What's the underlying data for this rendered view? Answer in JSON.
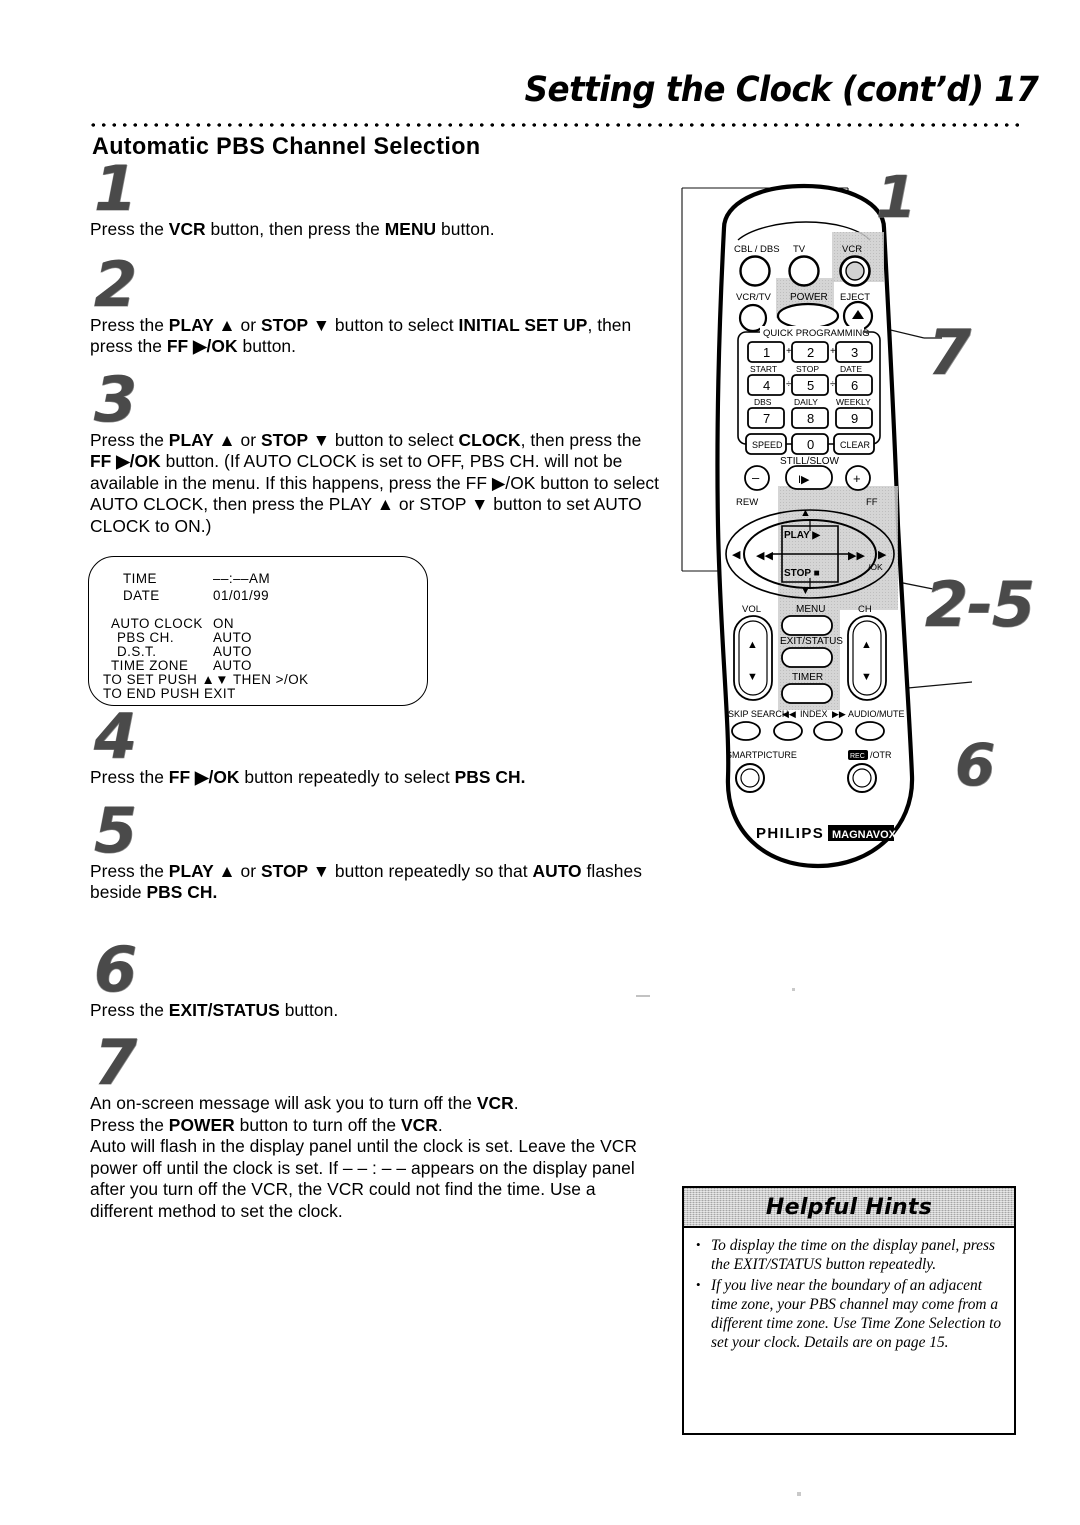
{
  "header": {
    "title": "Setting the Clock (cont’d)  17",
    "section_heading": "Automatic PBS Channel Selection"
  },
  "steps": [
    {
      "number": "1",
      "text_html": "Press the <b>VCR</b> button, then press the <b>MENU</b> button.",
      "plain": "Press the VCR button, then press the MENU button."
    },
    {
      "number": "2",
      "text_html": "Press the <b>PLAY ▲</b> or <b>STOP ▼</b> button to select <b>INITIAL SET UP</b>, then press the <b>FF ▶/OK</b> button.",
      "plain": "Press the PLAY ▲ or STOP ▼ button to select INITIAL SET UP, then press the FF ▶/OK button."
    },
    {
      "number": "3",
      "text_html": "Press the <b>PLAY ▲</b> or <b>STOP ▼</b> button to select <b>CLOCK</b>, then press the <b>FF ▶/OK</b> button.</b> <span class=\"reg\">(If AUTO CLOCK is set to OFF, PBS CH. will not be available in the menu. If this happens, press the FF ▶/OK button to select AUTO CLOCK, then press the PLAY ▲ or STOP ▼ button to set AUTO CLOCK to ON.)</span>",
      "plain": "Press the PLAY ▲ or STOP ▼ button to select CLOCK, then press the FF ▶/OK button. (If AUTO CLOCK is set to OFF, PBS CH. will not be available in the menu. If this happens, press the FF ▶/OK button to select AUTO CLOCK, then press the PLAY ▲ or STOP ▼ button to set AUTO CLOCK to ON.)"
    },
    {
      "number": "4",
      "text_html": "Press the <b>FF ▶/OK</b> button repeatedly to select <b>PBS CH.</b>",
      "plain": "Press the FF ▶/OK button repeatedly to select PBS CH."
    },
    {
      "number": "5",
      "text_html": "Press the <b>PLAY ▲</b> or <b>STOP ▼</b> button repeatedly so that <b>AUTO</b> flashes beside <b>PBS CH.</b>",
      "plain": "Press the PLAY ▲ or STOP ▼ button repeatedly so that AUTO flashes beside PBS CH."
    },
    {
      "number": "6",
      "text_html": "Press the <b>EXIT/STATUS</b> button.",
      "plain": "Press the EXIT/STATUS button."
    },
    {
      "number": "7",
      "text_html": "An on-screen message will ask you to turn off the <b>VCR</b>.<br>Press the <b>POWER</b> button to turn off the <b>VCR</b>.<br><span class=\"reg\">Auto will flash in the display panel until the clock is set. Leave the VCR power off until the clock is set. If – – : – – appears on the display panel after you turn off the VCR, the VCR could not find the time. Use a different method to set the clock.</span>",
      "plain": "An on-screen message will ask you to turn off the VCR. Press the POWER button to turn off the VCR. Auto will flash in the display panel until the clock is set. Leave the VCR power off until the clock is set. If – – : – – appears on the display panel after you turn off the VCR, the VCR could not find the time. Use a different method to set the clock."
    }
  ],
  "osd_menu": {
    "time_label": "TIME",
    "time_value": "––:––AM",
    "date_label": "DATE",
    "date_value": "01/01/99",
    "auto_clock_label": "AUTO CLOCK",
    "auto_clock_value": "ON",
    "pbs_ch_label": "PBS CH.",
    "pbs_ch_value": "AUTO",
    "dst_label": "D.S.T.",
    "dst_value": "AUTO",
    "time_zone_label": "TIME ZONE",
    "time_zone_value": "AUTO",
    "footer_1": "TO SET PUSH ▲▼ THEN >/OK",
    "footer_2": "TO END PUSH EXIT"
  },
  "callouts": {
    "one": "1",
    "seven": "7",
    "two_to_five": "2-5",
    "six": "6"
  },
  "remote": {
    "brand": "PHILIPS",
    "sub_brand": "MAGNAVOX",
    "top_buttons": [
      "CBL / DBS",
      "TV",
      "VCR"
    ],
    "second_row": [
      "VCR/TV",
      "POWER",
      "EJECT"
    ],
    "keypad_title": "QUICK PROGRAMMING",
    "keypad_keys": [
      "1",
      "2",
      "3",
      "4",
      "5",
      "6",
      "7",
      "8",
      "9",
      "SPEED",
      "0",
      "CLEAR"
    ],
    "keypad_sublabels_row1": [
      "START",
      "STOP",
      "DATE"
    ],
    "keypad_sublabels_row2": [
      "DBS",
      "DAILY",
      "WEEKLY"
    ],
    "still_slow": "STILL/SLOW",
    "minus": "–",
    "plus": "+",
    "rew": "REW",
    "ff": "FF",
    "play": "PLAY ▶",
    "stop": "STOP ■",
    "ok": "/OK",
    "vol": "VOL",
    "menu": "MENU",
    "ch": "CH",
    "exit_status": "EXIT/STATUS",
    "timer": "TIMER",
    "skip_search": "SKIP SEARCH",
    "index": "INDEX",
    "index_left_icon": "⏮",
    "index_right_icon": "⏭",
    "audio_mute": "AUDIO/MUTE",
    "smartpicture": "SMARTPICTURE",
    "rec": "REC",
    "rec_otr": "/OTR"
  },
  "hints": {
    "title": "Helpful Hints",
    "items": [
      "To display the time on the display panel, press the EXIT/STATUS button repeatedly.",
      "If you live near the boundary of an adjacent time zone, your PBS channel may come from a different time zone. Use Time Zone Selection to set your clock. Details are on page 15."
    ]
  }
}
